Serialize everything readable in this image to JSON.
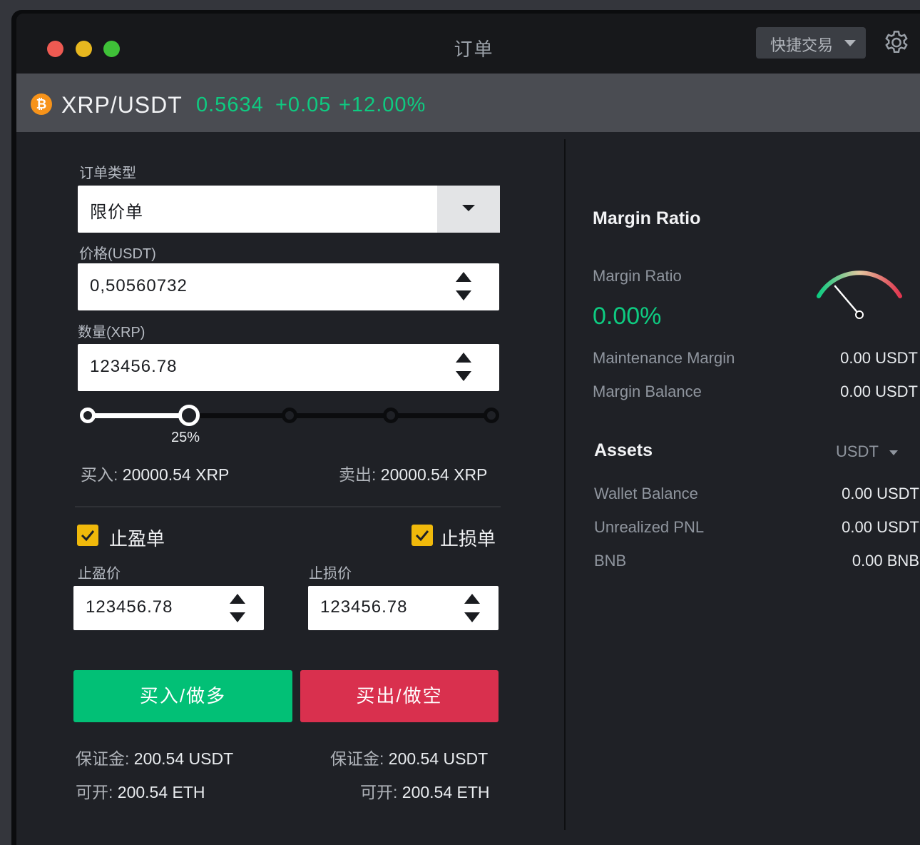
{
  "window": {
    "title": "订单",
    "quick_trade_label": "快捷交易"
  },
  "ticker": {
    "pair": "XRP/USDT",
    "last_price": "0.5634",
    "change": "+0.05",
    "change_pct": "+12.00%"
  },
  "order_form": {
    "order_type_label": "订单类型",
    "order_type_value": "限价单",
    "price_label": "价格(USDT)",
    "price_value": "0,50560732",
    "qty_label": "数量(XRP)",
    "qty_value": "123456.78",
    "slider_percent_label": "25%",
    "slider_percent": 25,
    "buy_label": "买入:",
    "buy_value": "20000.54 XRP",
    "sell_label": "卖出:",
    "sell_value": "20000.54 XRP",
    "take_profit_label": "止盈单",
    "stop_loss_label": "止损单",
    "take_profit_checked": true,
    "stop_loss_checked": true,
    "tp_price_label": "止盈价",
    "tp_price_value": "123456.78",
    "sl_price_label": "止损价",
    "sl_price_value": "123456.78",
    "buy_button": "买入/做多",
    "sell_button": "买出/做空",
    "margin_label_left": "保证金:",
    "margin_value_left": "200.54 USDT",
    "margin_label_right": "保证金:",
    "margin_value_right": "200.54 USDT",
    "available_label_left": "可开:",
    "available_value_left": "200.54 ETH",
    "available_label_right": "可开:",
    "available_value_right": "200.54 ETH"
  },
  "margin_panel": {
    "title": "Margin Ratio",
    "ratio_label": "Margin Ratio",
    "ratio_value": "0.00%",
    "maintenance_label": "Maintenance Margin",
    "maintenance_value": "0.00 USDT",
    "balance_label": "Margin Balance",
    "balance_value": "0.00 USDT"
  },
  "assets_panel": {
    "title": "Assets",
    "currency": "USDT",
    "rows": [
      {
        "label": "Wallet Balance",
        "value": "0.00 USDT"
      },
      {
        "label": "Unrealized PNL",
        "value": "0.00 USDT"
      },
      {
        "label": "BNB",
        "value": "0.00 BNB"
      }
    ]
  },
  "colors": {
    "up": "#0ecb81",
    "buy": "#02c076",
    "sell": "#d9304e",
    "accent": "#f0b90b"
  },
  "icons": [
    "settings-gear-icon",
    "bitcoin-coin-icon",
    "dropdown-caret-icon",
    "stepper-icon",
    "checkbox-check-icon",
    "margin-gauge-icon"
  ]
}
